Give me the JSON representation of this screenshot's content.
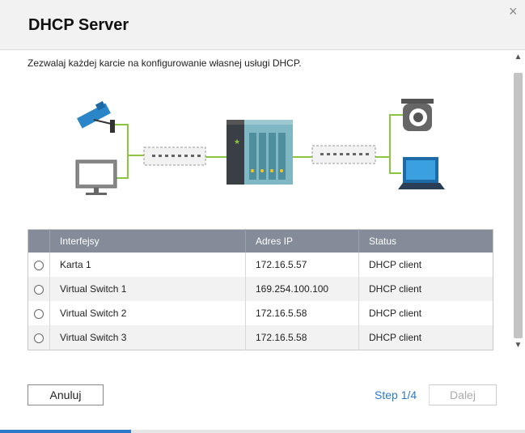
{
  "dialog": {
    "title": "DHCP Server",
    "close_symbol": "×"
  },
  "description": "Zezwalaj każdej karcie na konfigurowanie własnej usługi DHCP.",
  "diagram": {
    "devices": [
      "camera-icon",
      "monitor-icon",
      "switch-icon",
      "nas-icon",
      "switch-icon",
      "dome-camera-icon",
      "laptop-icon"
    ]
  },
  "table": {
    "headers": {
      "select": "",
      "interface": "Interfejsy",
      "ip": "Adres IP",
      "status": "Status"
    },
    "rows": [
      {
        "interface": "Karta 1",
        "ip": "172.16.5.57",
        "status": "DHCP client"
      },
      {
        "interface": "Virtual Switch 1",
        "ip": "169.254.100.100",
        "status": "DHCP client"
      },
      {
        "interface": "Virtual Switch 2",
        "ip": "172.16.5.58",
        "status": "DHCP client"
      },
      {
        "interface": "Virtual Switch 3",
        "ip": "172.16.5.58",
        "status": "DHCP client"
      }
    ]
  },
  "footer": {
    "cancel_label": "Anuluj",
    "step_text": "Step 1/4",
    "next_label": "Dalej"
  },
  "progress": {
    "fraction": 0.25
  },
  "colors": {
    "accent": "#2a7ac9",
    "header_row": "#838c98",
    "link_green": "#8cc63f"
  }
}
